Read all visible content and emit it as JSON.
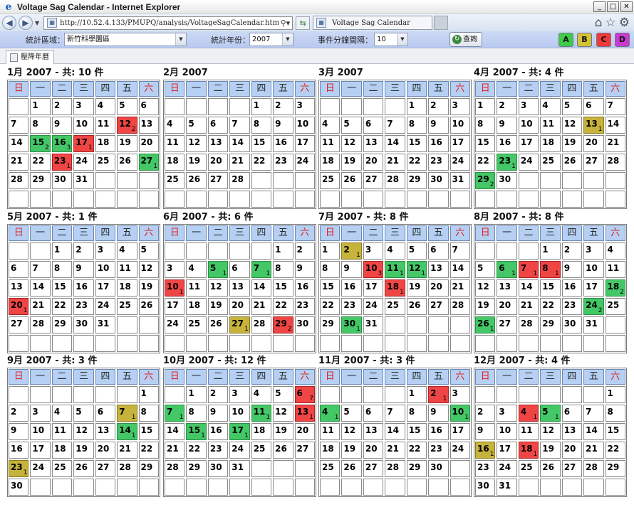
{
  "window": {
    "title": "Voltage Sag Calendar - Internet Explorer"
  },
  "browser": {
    "address": "http://10.52.4.133/PMUPQ/analysis/VoltageSagCalendar.html?locale=zh_T",
    "tab_title": "Voltage Sag Calendar"
  },
  "filters": {
    "area_label": "統計區域：",
    "area_value": "新竹科學園區",
    "year_label": "統計年份：",
    "year_value": "2007",
    "interval_label": "事件分鐘間隔：",
    "interval_value": "10",
    "query_label": "查詢"
  },
  "levels": [
    {
      "label": "A",
      "color": "#3ccc4a"
    },
    {
      "label": "B",
      "color": "#d4c13a"
    },
    {
      "label": "C",
      "color": "#f03a3a"
    },
    {
      "label": "D",
      "color": "#c83ad0"
    }
  ],
  "page_tab": {
    "label": "壓降年曆"
  },
  "weekdays": [
    "日",
    "一",
    "二",
    "三",
    "四",
    "五",
    "六"
  ],
  "year": 2007,
  "months": [
    {
      "title": "1月 2007 - 共: 10 件",
      "month": 1,
      "events": [
        {
          "day": 12,
          "count": 2,
          "level": "C"
        },
        {
          "day": 15,
          "count": 2,
          "level": "A"
        },
        {
          "day": 16,
          "count": 3,
          "level": "A"
        },
        {
          "day": 17,
          "count": 1,
          "level": "C"
        },
        {
          "day": 23,
          "count": 1,
          "level": "C"
        },
        {
          "day": 27,
          "count": 1,
          "level": "A"
        }
      ]
    },
    {
      "title": "2月 2007",
      "month": 2,
      "events": []
    },
    {
      "title": "3月 2007",
      "month": 3,
      "events": []
    },
    {
      "title": "4月 2007 - 共: 4 件",
      "month": 4,
      "events": [
        {
          "day": 13,
          "count": 1,
          "level": "B"
        },
        {
          "day": 23,
          "count": 1,
          "level": "A"
        },
        {
          "day": 29,
          "count": 2,
          "level": "A"
        }
      ]
    },
    {
      "title": "5月 2007 - 共: 1 件",
      "month": 5,
      "events": [
        {
          "day": 20,
          "count": 1,
          "level": "C"
        }
      ]
    },
    {
      "title": "6月 2007 - 共: 6 件",
      "month": 6,
      "events": [
        {
          "day": 5,
          "count": 1,
          "level": "A"
        },
        {
          "day": 7,
          "count": 1,
          "level": "A"
        },
        {
          "day": 10,
          "count": 1,
          "level": "C"
        },
        {
          "day": 27,
          "count": 1,
          "level": "B"
        },
        {
          "day": 29,
          "count": 2,
          "level": "C"
        }
      ]
    },
    {
      "title": "7月 2007 - 共: 8 件",
      "month": 7,
      "events": [
        {
          "day": 2,
          "count": 1,
          "level": "B"
        },
        {
          "day": 10,
          "count": 3,
          "level": "C"
        },
        {
          "day": 11,
          "count": 1,
          "level": "A"
        },
        {
          "day": 12,
          "count": 1,
          "level": "A"
        },
        {
          "day": 18,
          "count": 1,
          "level": "C"
        },
        {
          "day": 30,
          "count": 1,
          "level": "A"
        }
      ]
    },
    {
      "title": "8月 2007 - 共: 8 件",
      "month": 8,
      "events": [
        {
          "day": 6,
          "count": 1,
          "level": "A"
        },
        {
          "day": 7,
          "count": 1,
          "level": "C"
        },
        {
          "day": 8,
          "count": 1,
          "level": "C"
        },
        {
          "day": 18,
          "count": 2,
          "level": "A"
        },
        {
          "day": 24,
          "count": 2,
          "level": "A"
        },
        {
          "day": 26,
          "count": 1,
          "level": "A"
        }
      ]
    },
    {
      "title": "9月 2007 - 共: 3 件",
      "month": 9,
      "events": [
        {
          "day": 7,
          "count": 1,
          "level": "B"
        },
        {
          "day": 14,
          "count": 1,
          "level": "A"
        },
        {
          "day": 23,
          "count": 1,
          "level": "B"
        }
      ]
    },
    {
      "title": "10月 2007 - 共: 12 件",
      "month": 10,
      "events": [
        {
          "day": 6,
          "count": 7,
          "level": "C"
        },
        {
          "day": 7,
          "count": 1,
          "level": "A"
        },
        {
          "day": 11,
          "count": 1,
          "level": "A"
        },
        {
          "day": 13,
          "count": 1,
          "level": "C"
        },
        {
          "day": 15,
          "count": 1,
          "level": "A"
        },
        {
          "day": 17,
          "count": 1,
          "level": "A"
        }
      ]
    },
    {
      "title": "11月 2007 - 共: 3 件",
      "month": 11,
      "events": [
        {
          "day": 2,
          "count": 1,
          "level": "C"
        },
        {
          "day": 4,
          "count": 1,
          "level": "A"
        },
        {
          "day": 10,
          "count": 1,
          "level": "A"
        }
      ]
    },
    {
      "title": "12月 2007 - 共: 4 件",
      "month": 12,
      "events": [
        {
          "day": 4,
          "count": 1,
          "level": "C"
        },
        {
          "day": 5,
          "count": 1,
          "level": "A"
        },
        {
          "day": 16,
          "count": 1,
          "level": "B"
        },
        {
          "day": 18,
          "count": 1,
          "level": "C"
        }
      ]
    }
  ]
}
